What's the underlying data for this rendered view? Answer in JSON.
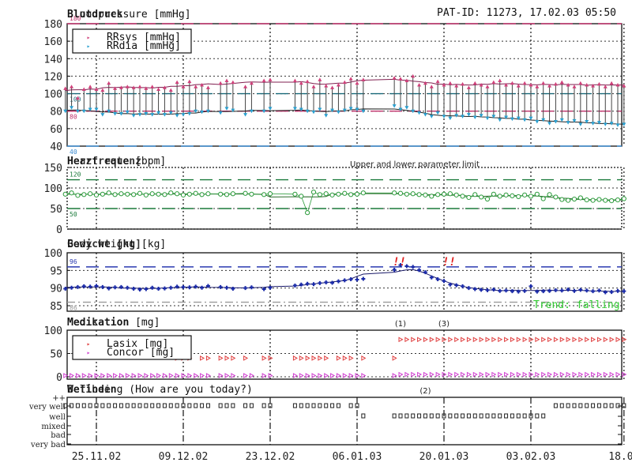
{
  "header": {
    "patient_id": "PAT-ID: 11273, 17.02.03 05:50"
  },
  "chart_data": {
    "type": "line",
    "xlim": [
      "20.11.02",
      "18.02.03"
    ],
    "x_tick_labels": [
      "25.11.02",
      "09.12.02",
      "23.12.02",
      "06.01.03",
      "20.01.03",
      "03.02.03",
      "18.02"
    ],
    "grid": true,
    "x": [
      "20.11.02",
      "21.11.02",
      "22.11.02",
      "23.11.02",
      "24.11.02",
      "25.11.02",
      "26.11.02",
      "27.11.02",
      "28.11.02",
      "29.11.02",
      "30.11.02",
      "01.12.02",
      "02.12.02",
      "03.12.02",
      "04.12.02",
      "05.12.02",
      "06.12.02",
      "07.12.02",
      "08.12.02",
      "09.12.02",
      "10.12.02",
      "11.12.02",
      "12.12.02",
      "13.12.02",
      "15.12.02",
      "16.12.02",
      "17.12.02",
      "19.12.02",
      "20.12.02",
      "22.12.02",
      "23.12.02",
      "27.12.02",
      "28.12.02",
      "29.12.02",
      "30.12.02",
      "31.12.02",
      "01.01.03",
      "02.01.03",
      "03.01.03",
      "04.01.03",
      "05.01.03",
      "06.01.03",
      "07.01.03",
      "12.01.03",
      "13.01.03",
      "14.01.03",
      "15.01.03",
      "16.01.03",
      "17.01.03",
      "18.01.03",
      "19.01.03",
      "20.01.03",
      "21.01.03",
      "22.01.03",
      "23.01.03",
      "24.01.03",
      "25.01.03",
      "26.01.03",
      "27.01.03",
      "28.01.03",
      "29.01.03",
      "30.01.03",
      "31.01.03",
      "01.02.03",
      "02.02.03",
      "03.02.03",
      "04.02.03",
      "05.02.03",
      "06.02.03",
      "07.02.03",
      "08.02.03",
      "09.02.03",
      "10.02.03",
      "11.02.03",
      "12.02.03",
      "13.02.03",
      "14.02.03",
      "15.02.03",
      "16.02.03",
      "17.02.03",
      "18.02.03"
    ],
    "panels": [
      {
        "id": "bp",
        "title": "Bloodpressure [mmHg]",
        "title_overlay": "Blutdruck",
        "ylim": [
          40,
          180
        ],
        "yticks": [
          40,
          60,
          80,
          100,
          120,
          140,
          160,
          180
        ],
        "limits": [
          {
            "value": 180,
            "label": "180",
            "color": "#c0306a"
          },
          {
            "value": 100,
            "label": "100",
            "color": "#1a6a7a"
          },
          {
            "value": 80,
            "label": "80",
            "color": "#c0306a"
          },
          {
            "value": 40,
            "label": "40",
            "color": "#3a8ad0"
          }
        ],
        "legend": "top-left",
        "series": [
          {
            "name": "RRsys [mmHg]",
            "color": "#d0407a",
            "marker": "triangle-up",
            "values": [
              106,
              108,
              95,
              105,
              108,
              105,
              104,
              112,
              106,
              107,
              108,
              107,
              108,
              106,
              108,
              105,
              107,
              104,
              113,
              108,
              114,
              108,
              110,
              107,
              112,
              115,
              113,
              108,
              112,
              115,
              116,
              115,
              112,
              114,
              108,
              116,
              109,
              107,
              110,
              113,
              117,
              112,
              116,
              118,
              117,
              115,
              120,
              110,
              112,
              108,
              114,
              110,
              112,
              109,
              111,
              107,
              112,
              110,
              108,
              113,
              115,
              110,
              112,
              109,
              112,
              110,
              108,
              112,
              109,
              111,
              113,
              110,
              108,
              112,
              110,
              109,
              111,
              108,
              112,
              110,
              109
            ]
          },
          {
            "name": "RRdia [mmHg]",
            "color": "#2aa0d0",
            "marker": "triangle-down",
            "values": [
              80,
              84,
              80,
              80,
              82,
              82,
              76,
              80,
              77,
              77,
              79,
              75,
              76,
              77,
              76,
              78,
              76,
              78,
              75,
              76,
              77,
              80,
              79,
              80,
              78,
              83,
              81,
              76,
              80,
              80,
              83,
              83,
              82,
              80,
              79,
              82,
              75,
              81,
              79,
              81,
              83,
              82,
              80,
              86,
              82,
              84,
              80,
              78,
              76,
              74,
              78,
              74,
              72,
              75,
              74,
              76,
              73,
              75,
              72,
              74,
              70,
              73,
              71,
              72,
              70,
              72,
              68,
              70,
              66,
              68,
              70,
              67,
              69,
              65,
              68,
              66,
              67,
              65,
              66,
              64,
              65,
              64
            ]
          }
        ]
      },
      {
        "id": "hr",
        "title": "Heart rate [bpm]",
        "title_overlay": "Herzfrequenz",
        "ylim": [
          0,
          150
        ],
        "yticks": [
          0,
          50,
          100,
          150
        ],
        "annotation": "Upper and lower parameter limit",
        "limits": [
          {
            "value": 120,
            "label": "120",
            "color": "#1a7a3a"
          },
          {
            "value": 50,
            "label": "50",
            "color": "#1a7a3a"
          }
        ],
        "series": [
          {
            "name": "Heart rate",
            "color": "#2a9a3a",
            "marker": "circle",
            "values": [
              85,
              88,
              82,
              84,
              86,
              83,
              85,
              88,
              84,
              86,
              85,
              84,
              87,
              83,
              86,
              85,
              84,
              88,
              86,
              83,
              85,
              87,
              84,
              86,
              85,
              84,
              86,
              87,
              85,
              84,
              86,
              85,
              80,
              40,
              90,
              84,
              86,
              83,
              85,
              87,
              84,
              85,
              88,
              88,
              87,
              85,
              86,
              84,
              83,
              80,
              84,
              85,
              86,
              83,
              80,
              77,
              84,
              78,
              73,
              85,
              80,
              83,
              81,
              79,
              83,
              80,
              85,
              74,
              84,
              78,
              72,
              70,
              73,
              76,
              71,
              70,
              72,
              70,
              69,
              71,
              74
            ]
          }
        ]
      },
      {
        "id": "weight",
        "title": "Body weight [kg]",
        "title_overlay": "Gewicht [kg]",
        "ylim": [
          85,
          100
        ],
        "yticks": [
          85,
          90,
          95,
          100
        ],
        "limits": [
          {
            "value": 96,
            "label": "96",
            "color": "#2a3ab0"
          },
          {
            "value": 86,
            "label": "86",
            "color": "#9a9a9a"
          }
        ],
        "trend_label": "Trend: falling",
        "alerts": [
          {
            "date": "12.01.03",
            "text": "!!"
          },
          {
            "date": "20.01.03",
            "text": "!!"
          }
        ],
        "series": [
          {
            "name": "Body weight",
            "color": "#1a2aa8",
            "marker": "plus",
            "values": [
              89.8,
              90.1,
              90.3,
              90.5,
              90.4,
              90.6,
              90.3,
              89.9,
              90.2,
              90.3,
              90.1,
              89.8,
              89.6,
              89.7,
              90.1,
              89.8,
              89.9,
              90.1,
              90.4,
              90.3,
              90.2,
              90.4,
              90.1,
              90.6,
              90.3,
              90.1,
              89.8,
              90.0,
              90.2,
              89.7,
              90.1,
              90.7,
              91.0,
              91.2,
              91.1,
              91.4,
              91.6,
              91.5,
              91.9,
              92.2,
              92.5,
              92.4,
              92.6,
              95.2,
              96.5,
              96.2,
              96.0,
              95.1,
              94.5,
              93.0,
              92.5,
              92.0,
              91.0,
              90.8,
              90.5,
              90.0,
              89.7,
              89.5,
              89.4,
              89.6,
              89.2,
              89.3,
              89.1,
              89.0,
              89.2,
              90.5,
              89.0,
              89.1,
              89.2,
              89.4,
              89.3,
              89.6,
              89.2,
              89.5,
              89.3,
              89.1,
              89.3,
              88.8,
              88.9,
              89.2,
              89.1
            ]
          }
        ]
      },
      {
        "id": "medication",
        "title": "Medication [mg]",
        "title_overlay": "Medikation",
        "ylim": [
          0,
          100
        ],
        "yticks": [
          0,
          50,
          100
        ],
        "legend": "top-left",
        "annotations": [
          {
            "date": "13.01.03",
            "text": "(1)"
          },
          {
            "date": "20.01.03",
            "text": "(3)"
          }
        ],
        "series": [
          {
            "name": "Lasix [mg]",
            "color": "#e04040",
            "marker": "triangle-right",
            "values": [
              null,
              null,
              null,
              null,
              null,
              null,
              null,
              null,
              null,
              null,
              null,
              null,
              null,
              null,
              null,
              null,
              null,
              null,
              40,
              40,
              40,
              null,
              40,
              40,
              40,
              40,
              40,
              40,
              null,
              40,
              40,
              40,
              40,
              40,
              40,
              40,
              40,
              null,
              40,
              40,
              40,
              null,
              40,
              40,
              80,
              80,
              80,
              80,
              80,
              80,
              80,
              80,
              80,
              80,
              80,
              80,
              80,
              80,
              80,
              80,
              80,
              80,
              80,
              80,
              80,
              80,
              80,
              80,
              80,
              80,
              80,
              80,
              80,
              80,
              80,
              80,
              80,
              80,
              80,
              80,
              80
            ]
          },
          {
            "name": "Concor [mg]",
            "color": "#d040d0",
            "marker": "triangle-right",
            "values": [
              2.5,
              2.5,
              2.5,
              2.5,
              2.5,
              2.5,
              2.5,
              2.5,
              2.5,
              2.5,
              2.5,
              2.5,
              2.5,
              2.5,
              2.5,
              2.5,
              2.5,
              2.5,
              2.5,
              2.5,
              2.5,
              2.5,
              2.5,
              2.5,
              2.5,
              2.5,
              2.5,
              2.5,
              2.5,
              2.5,
              2.5,
              2.5,
              2.5,
              2.5,
              2.5,
              2.5,
              2.5,
              2.5,
              2.5,
              2.5,
              2.5,
              2.5,
              2.5,
              2.5,
              5,
              5,
              5,
              5,
              5,
              5,
              5,
              5,
              5,
              5,
              5,
              5,
              5,
              5,
              5,
              5,
              5,
              5,
              5,
              5,
              5,
              5,
              5,
              5,
              5,
              5,
              5,
              5,
              5,
              5,
              5,
              5,
              5,
              5,
              5,
              5,
              5
            ]
          }
        ]
      },
      {
        "id": "wellbeing",
        "title": "Wellbeing  (How are you today?)",
        "title_overlay": "Befinden",
        "y_categories": [
          "very bad",
          "bad",
          "mixed",
          "well",
          "very well",
          "++"
        ],
        "annotations": [
          {
            "date": "17.01.03",
            "text": "(2)"
          }
        ],
        "series": [
          {
            "name": "Wellbeing",
            "color": "#222222",
            "marker": "square",
            "values": [
              "very well",
              "very well",
              "very well",
              "very well",
              "very well",
              "very well",
              "very well",
              "very well",
              "very well",
              "very well",
              "very well",
              "very well",
              "very well",
              "very well",
              "very well",
              "very well",
              "very well",
              "very well",
              "very well",
              "very well",
              "very well",
              "very well",
              "very well",
              "very well",
              "very well",
              "very well",
              "very well",
              "very well",
              "very well",
              "very well",
              "very well",
              "very well",
              "very well",
              "very well",
              "very well",
              "very well",
              "very well",
              "very well",
              "very well",
              null,
              "very well",
              "very well",
              "well",
              "well",
              "well",
              "well",
              "well",
              "well",
              "well",
              "well",
              "well",
              "well",
              "well",
              "well",
              "well",
              "well",
              "well",
              "well",
              "well",
              "well",
              "well",
              "well",
              "well",
              "well",
              "well",
              "well",
              "well",
              "well",
              null,
              "very well",
              "very well",
              "very well",
              "very well",
              "very well",
              "very well",
              "very well",
              "very well",
              "very well",
              "very well",
              "very well",
              "very well"
            ]
          }
        ]
      }
    ]
  }
}
